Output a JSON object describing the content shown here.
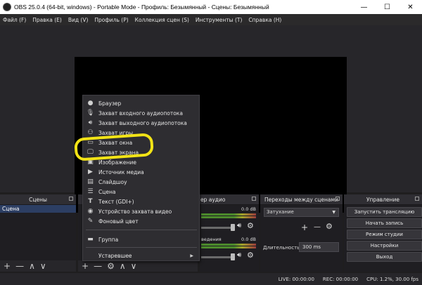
{
  "window": {
    "title": "OBS 25.0.4 (64-bit, windows) - Portable Mode - Профиль: Безымянный - Сцены: Безымянный",
    "minimize": "—",
    "maximize": "☐",
    "close": "✕"
  },
  "menu": [
    "Файл (F)",
    "Правка (E)",
    "Вид (V)",
    "Профиль (P)",
    "Коллекция сцен (S)",
    "Инструменты (T)",
    "Справка (H)"
  ],
  "docks": {
    "scenes": {
      "title": "Сцены",
      "items": [
        "Сцена"
      ]
    },
    "mixer": {
      "title": "ер аудио",
      "track1_db": "0.0 dB",
      "track2_label": "ведения",
      "track2_db": "0.0 dB"
    },
    "transitions": {
      "title": "Переходы между сценами",
      "selected": "Затухание",
      "duration_label": "Длительность",
      "duration_value": "300 ms",
      "add": "+",
      "remove": "—"
    },
    "controls": {
      "title": "Управление",
      "buttons": [
        "Запустить трансляцию",
        "Начать запись",
        "Режим студии",
        "Настройки",
        "Выход"
      ]
    }
  },
  "toolbar": {
    "add": "+",
    "remove": "—",
    "up": "∧",
    "down": "∨"
  },
  "status": {
    "live": "LIVE: 00:00:00",
    "rec": "REC: 00:00:00",
    "cpu": "CPU: 1.2%, 30.00 fps"
  },
  "context_menu": {
    "items": [
      {
        "label": "Браузер",
        "icon": "globe-icon"
      },
      {
        "label": "Захват входного аудиопотока",
        "icon": "microphone-icon"
      },
      {
        "label": "Захват выходного аудиопотока",
        "icon": "speaker-icon"
      },
      {
        "label": "Захват игры",
        "icon": "gamepad-icon"
      },
      {
        "label": "Захват окна",
        "icon": "window-icon"
      },
      {
        "label": "Захват экрана",
        "icon": "monitor-icon"
      },
      {
        "label": "Изображение",
        "icon": "image-icon"
      },
      {
        "label": "Источник медиа",
        "icon": "play-icon"
      },
      {
        "label": "Слайдшоу",
        "icon": "slideshow-icon"
      },
      {
        "label": "Сцена",
        "icon": "list-icon"
      },
      {
        "label": "Текст (GDI+)",
        "icon": "text-icon"
      },
      {
        "label": "Устройство захвата видео",
        "icon": "camera-icon"
      },
      {
        "label": "Фоновый цвет",
        "icon": "brush-icon"
      }
    ],
    "group": {
      "label": "Группа",
      "icon": "folder-icon"
    },
    "deprecated": {
      "label": "Устаревшее",
      "arrow": "▶"
    }
  },
  "colors": {
    "highlight": "#f2e316",
    "selected_scene": "#2c3e63"
  }
}
